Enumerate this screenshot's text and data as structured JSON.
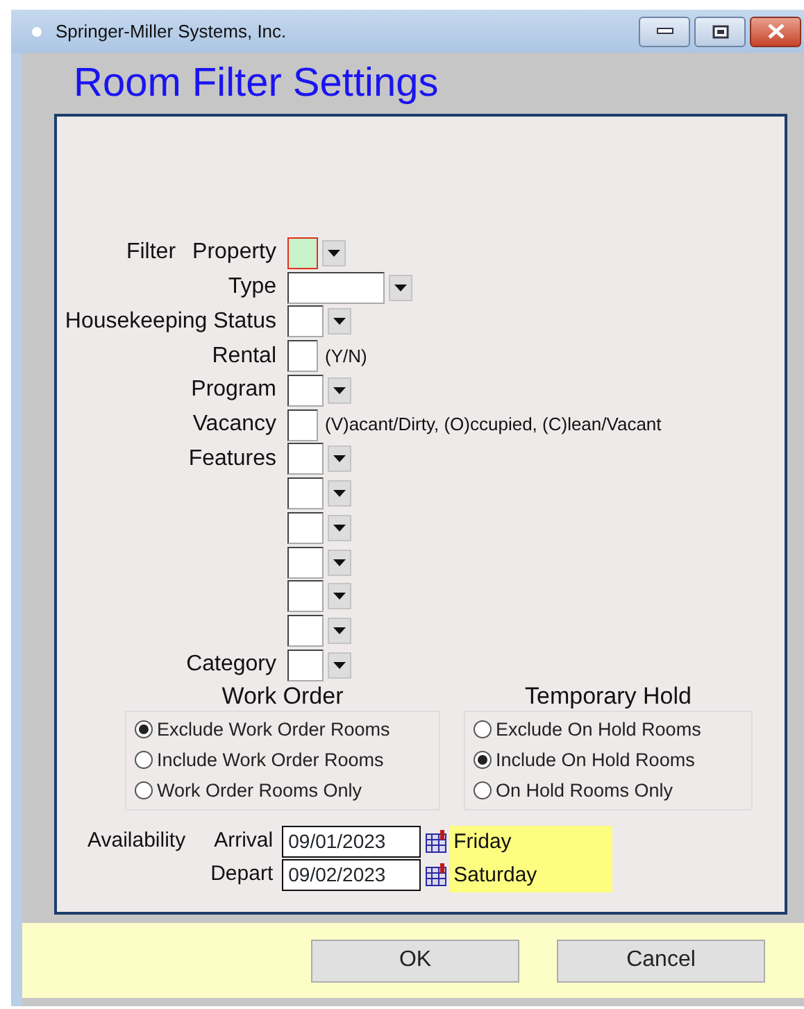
{
  "window": {
    "title": "Springer-Miller Systems, Inc."
  },
  "heading": "Room Filter Settings",
  "filter": {
    "label": "Filter",
    "fields": [
      {
        "label": "Property",
        "kind": "small-dropdown",
        "focused": true
      },
      {
        "label": "Type",
        "kind": "wide-dropdown",
        "focused": false
      },
      {
        "label": "Housekeeping Status",
        "kind": "dropdown",
        "focused": false
      },
      {
        "label": "Rental",
        "kind": "text",
        "hint": "(Y/N)",
        "focused": false
      },
      {
        "label": "Program",
        "kind": "dropdown",
        "focused": false
      },
      {
        "label": "Vacancy",
        "kind": "text",
        "hint": "(V)acant/Dirty, (O)ccupied, (C)lean/Vacant",
        "focused": false
      },
      {
        "label": "Features",
        "kind": "dropdown",
        "focused": false
      },
      {
        "kind": "dropdown",
        "focused": false
      },
      {
        "kind": "dropdown",
        "focused": false
      },
      {
        "kind": "dropdown",
        "focused": false
      },
      {
        "kind": "dropdown",
        "focused": false
      },
      {
        "kind": "dropdown",
        "focused": false
      },
      {
        "label": "Category",
        "kind": "dropdown",
        "focused": false
      }
    ]
  },
  "option_groups": [
    {
      "title": "Work Order",
      "options": [
        {
          "label": "Exclude Work Order Rooms",
          "selected": true
        },
        {
          "label": "Include Work Order Rooms",
          "selected": false
        },
        {
          "label": "Work Order Rooms Only",
          "selected": false
        }
      ]
    },
    {
      "title": "Temporary Hold",
      "options": [
        {
          "label": "Exclude On Hold Rooms",
          "selected": false
        },
        {
          "label": "Include On Hold Rooms",
          "selected": true
        },
        {
          "label": "On Hold Rooms Only",
          "selected": false
        }
      ]
    }
  ],
  "availability": {
    "label": "Availability",
    "dates": [
      {
        "label": "Arrival",
        "value": "09/01/2023",
        "day": "Friday"
      },
      {
        "label": "Depart",
        "value": "09/02/2023",
        "day": "Saturday"
      }
    ]
  },
  "buttons": [
    "OK",
    "Cancel"
  ]
}
